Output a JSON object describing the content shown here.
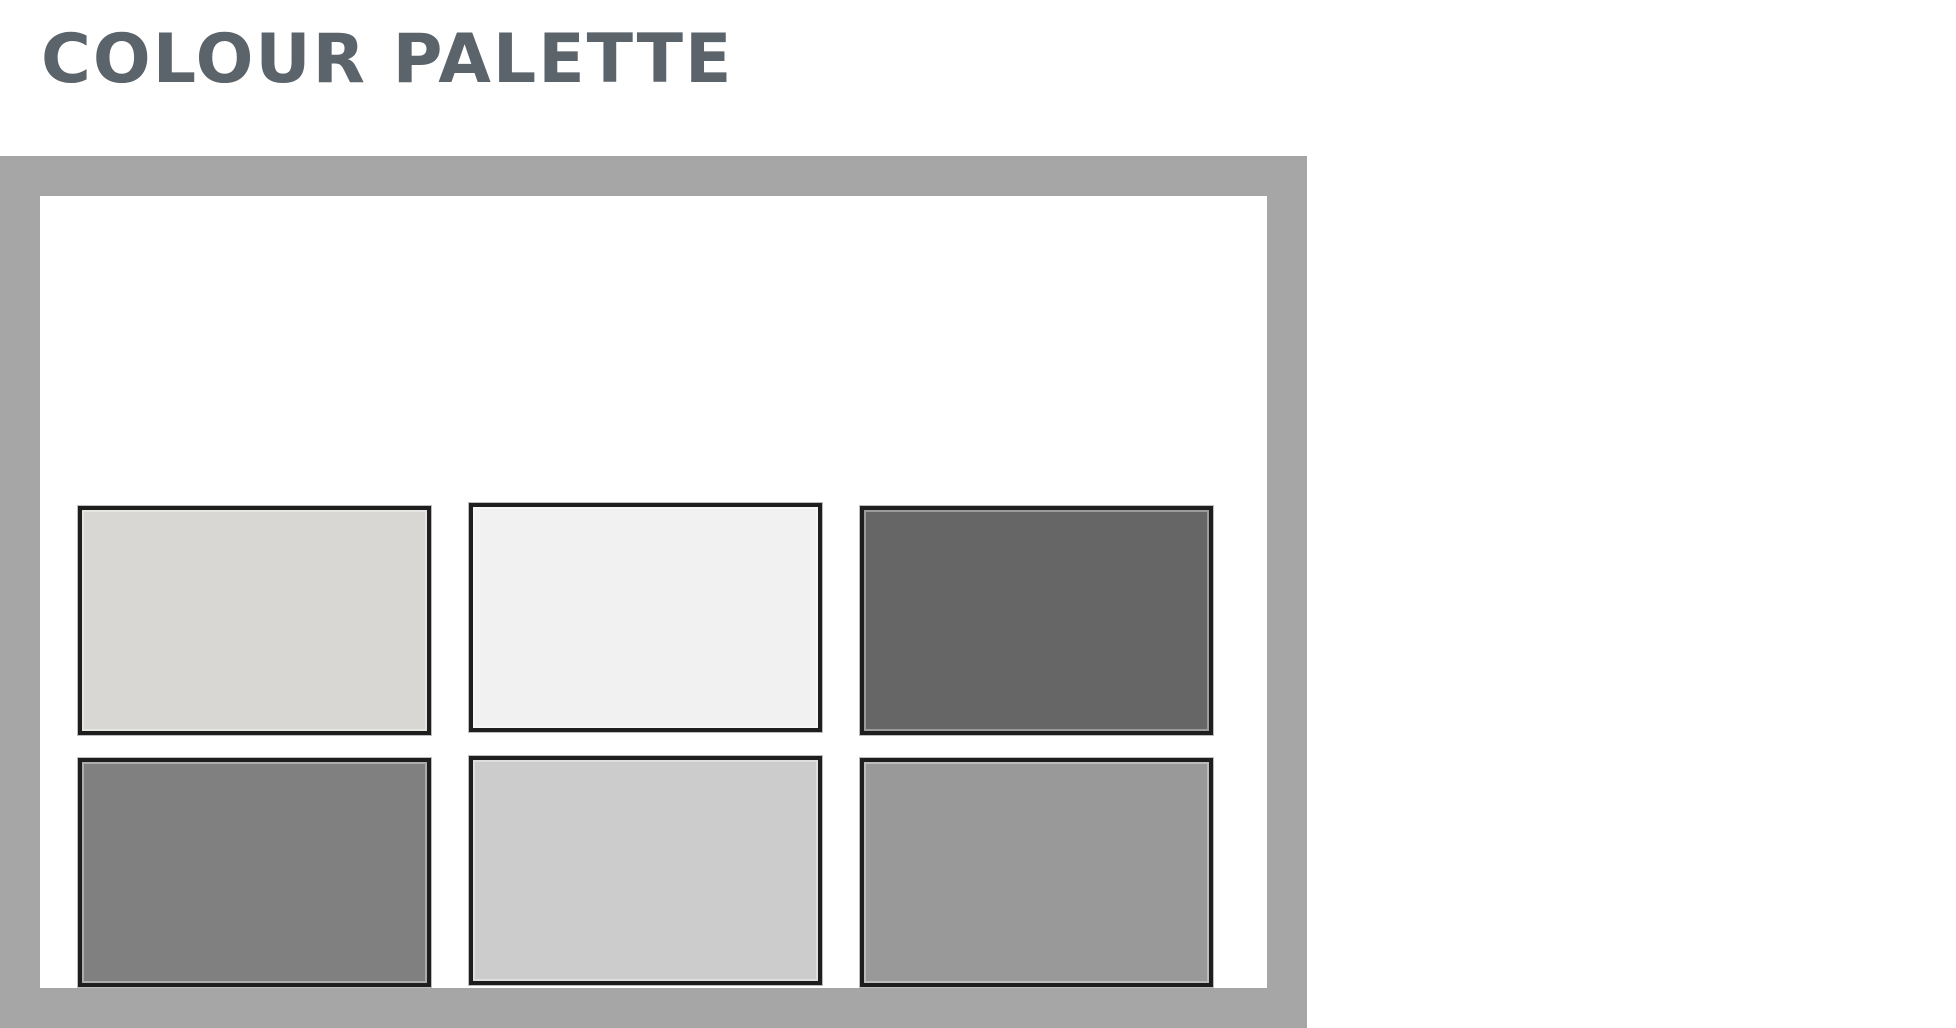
{
  "header": {
    "title": "COLOUR PALETTE",
    "title_color": "#5b636b"
  },
  "frame": {
    "border_color": "#a6a6a6",
    "background": "#ffffff"
  },
  "palette": {
    "swatches": [
      {
        "color": "#d8d7d3"
      },
      {
        "color": "#f1f1f1"
      },
      {
        "color": "#666666"
      },
      {
        "color": "#808080"
      },
      {
        "color": "#cccccc"
      },
      {
        "color": "#999999"
      }
    ],
    "swatch_border_color": "#1e1e1e"
  }
}
